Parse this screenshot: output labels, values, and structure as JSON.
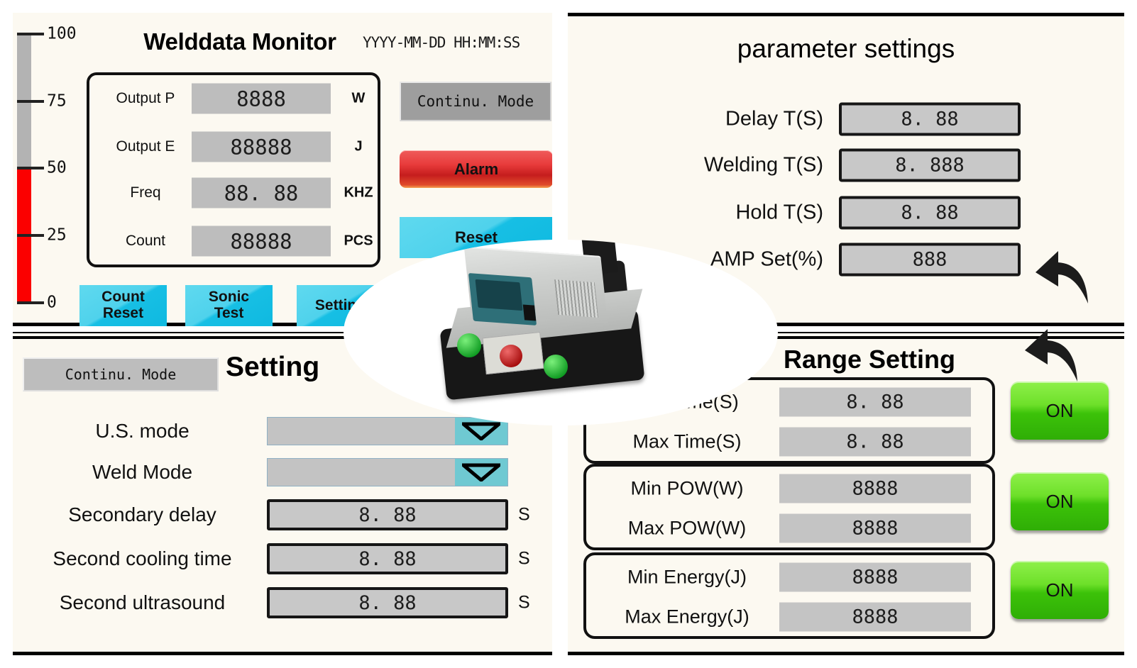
{
  "monitor_panel": {
    "title": "Welddata Monitor",
    "datetime": "YYYY-MM-DD HH:MM:SS",
    "gauge": {
      "ticks": [
        "100",
        "75",
        "50",
        "25",
        "0"
      ],
      "min": 0,
      "max": 100,
      "value": 50,
      "fill_color": "#fb0000",
      "track_color": "#b3b3b3"
    },
    "readouts": [
      {
        "label": "Output P",
        "value": "8888",
        "unit": "W"
      },
      {
        "label": "Output E",
        "value": "88888",
        "unit": "J"
      },
      {
        "label": "Freq",
        "value": "88. 88",
        "unit": "KHZ"
      },
      {
        "label": "Count",
        "value": "88888",
        "unit": "PCS"
      }
    ],
    "mode_button": "Continu. Mode",
    "alarm_button": "Alarm",
    "reset_button": "Reset",
    "action_buttons": [
      {
        "label": "Count\nReset"
      },
      {
        "label": "Sonic\nTest"
      },
      {
        "label": "Setting"
      }
    ]
  },
  "parameter_panel": {
    "title": "parameter settings",
    "rows": [
      {
        "label": "Delay T(S)",
        "value": "8. 88"
      },
      {
        "label": "Welding T(S)",
        "value": "8. 888"
      },
      {
        "label": "Hold T(S)",
        "value": "8. 88"
      },
      {
        "label": "AMP Set(%)",
        "value": "888"
      }
    ]
  },
  "setting_panel": {
    "mode_button": "Continu. Mode",
    "title": "Setting",
    "rows": [
      {
        "label": "U.S. mode",
        "type": "combo",
        "value": "",
        "unit": ""
      },
      {
        "label": "Weld Mode",
        "type": "combo",
        "value": "",
        "unit": ""
      },
      {
        "label": "Secondary delay",
        "type": "field",
        "value": "8. 88",
        "unit": "S"
      },
      {
        "label": "Second cooling time",
        "type": "field",
        "value": "8. 88",
        "unit": "S"
      },
      {
        "label": "Second ultrasound",
        "type": "field",
        "value": "8. 88",
        "unit": "S"
      }
    ]
  },
  "range_panel": {
    "title": "Range Setting",
    "groups": [
      {
        "rows": [
          {
            "label": "Min Time(S)",
            "value": "8. 88"
          },
          {
            "label": "Max Time(S)",
            "value": "8. 88"
          }
        ],
        "toggle": "ON"
      },
      {
        "rows": [
          {
            "label": "Min POW(W)",
            "value": "8888"
          },
          {
            "label": "Max POW(W)",
            "value": "8888"
          }
        ],
        "toggle": "ON"
      },
      {
        "rows": [
          {
            "label": "Min Energy(J)",
            "value": "8888"
          },
          {
            "label": "Max Energy(J)",
            "value": "8888"
          }
        ],
        "toggle": "ON"
      }
    ]
  },
  "overlay": {
    "photo_caption": "ultrasonic-welder-machine"
  },
  "colors": {
    "panel_bg": "#fcf9f1",
    "field_bg": "#c8c8c8",
    "cyan_button": "#17bfe4",
    "red_alarm": "#e83b3b",
    "green_on": "#3cc209",
    "gauge_red": "#fb0000"
  }
}
